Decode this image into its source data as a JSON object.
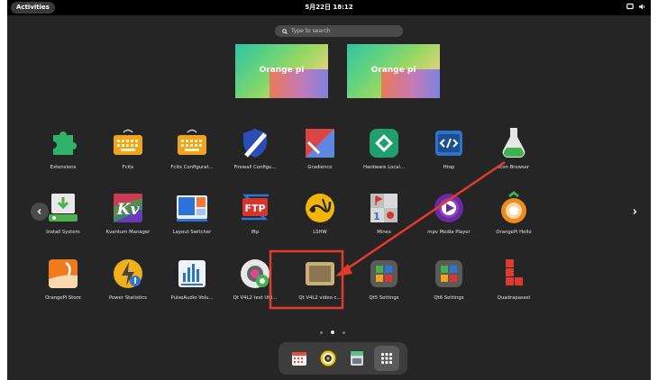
{
  "topbar": {
    "activities_label": "Activities",
    "clock": "5月22日 18:12"
  },
  "search": {
    "placeholder": "Type to search"
  },
  "workspaces": [
    {
      "logo_text": "Orange pi"
    },
    {
      "logo_text": "Orange pi"
    }
  ],
  "apps": [
    {
      "label": "Extensions",
      "icon": "puzzle-icon",
      "color": "#2fb36a"
    },
    {
      "label": "Fcitx",
      "icon": "keyboard-icon",
      "color": "#f0a51c"
    },
    {
      "label": "Fcitx Configurat...",
      "icon": "keyboard-icon",
      "color": "#f0a51c"
    },
    {
      "label": "Firewall Configu...",
      "icon": "shield-icon",
      "color": "#2b4db8"
    },
    {
      "label": "Gradience",
      "icon": "gradience-icon",
      "color": "#d94545"
    },
    {
      "label": "Hardware Local...",
      "icon": "hardware-icon",
      "color": "#1f9e6e"
    },
    {
      "label": "Htop",
      "icon": "code-icon",
      "color": "#2d73c9"
    },
    {
      "label": "Icon Browser",
      "icon": "flask-icon",
      "color": "#3fb34f"
    },
    {
      "label": "Install System",
      "icon": "install-icon",
      "color": "#4fae4f"
    },
    {
      "label": "Kvantum Manager",
      "icon": "kvantum-icon",
      "color": "#6a3bb5"
    },
    {
      "label": "Layout Switcher",
      "icon": "layout-icon",
      "color": "#2e74d6"
    },
    {
      "label": "lftp",
      "icon": "ftp-icon",
      "color": "#d9342b"
    },
    {
      "label": "LSHW",
      "icon": "lshw-icon",
      "color": "#f2b705"
    },
    {
      "label": "Mines",
      "icon": "mines-icon",
      "color": "#d9d9d9"
    },
    {
      "label": "mpv Media Player",
      "icon": "play-icon",
      "color": "#6b2b9e"
    },
    {
      "label": "OrangePi Hello",
      "icon": "gear-flower-icon",
      "color": "#f08a1c"
    },
    {
      "label": "OrangePi Store",
      "icon": "store-icon",
      "color": "#f07a1c"
    },
    {
      "label": "Power Statistics",
      "icon": "power-icon",
      "color": "#f0b01c"
    },
    {
      "label": "PulseAudio Volu...",
      "icon": "equalizer-icon",
      "color": "#2d73c9"
    },
    {
      "label": "Qt V4L2 test Util...",
      "icon": "camera-gear-icon",
      "color": "#d9d9d9"
    },
    {
      "label": "Qt V4L2 video c...",
      "icon": "video-icon",
      "color": "#c8b078"
    },
    {
      "label": "Qt5 Settings",
      "icon": "qt-settings-icon",
      "color": "#5a5a5a"
    },
    {
      "label": "Qt6 Settings",
      "icon": "qt-settings-icon",
      "color": "#5a5a5a"
    },
    {
      "label": "Quadrapassel",
      "icon": "tetris-icon",
      "color": "#e03a2e"
    }
  ],
  "dock": [
    {
      "icon": "calendar-icon"
    },
    {
      "icon": "speaker-icon"
    },
    {
      "icon": "file-cabinet-icon"
    },
    {
      "icon": "show-apps-grid-icon"
    }
  ],
  "annotation": {
    "highlight_color": "#e23b2e"
  }
}
